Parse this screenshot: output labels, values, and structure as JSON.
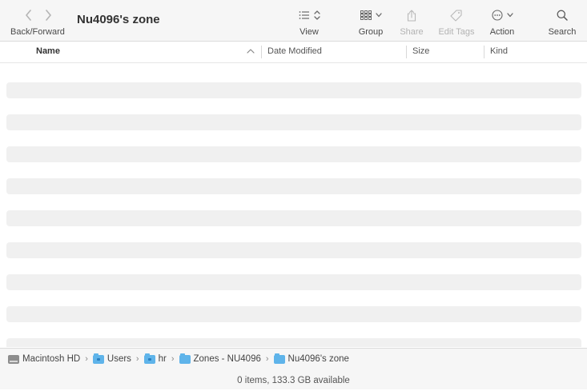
{
  "window": {
    "title": "Nu4096's zone"
  },
  "toolbar": {
    "nav_label": "Back/Forward",
    "view_label": "View",
    "group_label": "Group",
    "share_label": "Share",
    "edit_tags_label": "Edit Tags",
    "action_label": "Action",
    "search_label": "Search"
  },
  "columns": {
    "name": "Name",
    "date_modified": "Date Modified",
    "size": "Size",
    "kind": "Kind",
    "sort_indicator": "^"
  },
  "rows": [
    {},
    {},
    {},
    {},
    {},
    {},
    {},
    {}
  ],
  "path": [
    {
      "label": "Macintosh HD",
      "icon": "disk-icon"
    },
    {
      "label": "Users",
      "icon": "folder-icon"
    },
    {
      "label": "hr",
      "icon": "folder-icon"
    },
    {
      "label": "Zones - NU4096",
      "icon": "folder-icon"
    },
    {
      "label": "Nu4096's zone",
      "icon": "folder-icon"
    }
  ],
  "status": "0 items, 133.3 GB available"
}
